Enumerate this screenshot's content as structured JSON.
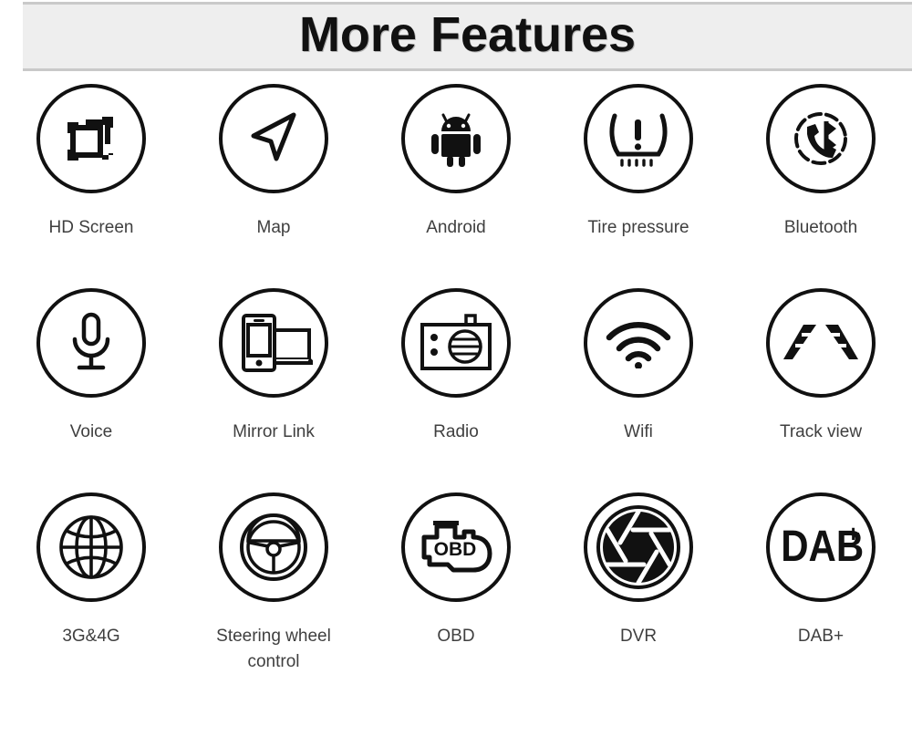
{
  "header": {
    "title": "More Features",
    "background_color": "#eeeeee",
    "border_color": "#c9c9c9",
    "text_color": "#111111"
  },
  "theme": {
    "page_background": "#ffffff",
    "icon_stroke": "#111111",
    "label_color": "#3f3f3f"
  },
  "grid": {
    "columns": 5,
    "rows": 3,
    "rows_data": [
      {
        "cells": [
          {
            "label": "HD Screen",
            "icon": "hd-screen-icon"
          },
          {
            "label": "Map",
            "icon": "navigation-arrow-icon"
          },
          {
            "label": "Android",
            "icon": "android-robot-icon"
          },
          {
            "label": "Tire pressure",
            "icon": "tire-pressure-warning-icon"
          },
          {
            "label": "Bluetooth",
            "icon": "bluetooth-handset-icon"
          }
        ]
      },
      {
        "cells": [
          {
            "label": "Voice",
            "icon": "microphone-icon"
          },
          {
            "label": "Mirror Link",
            "icon": "phone-screen-mirror-icon"
          },
          {
            "label": "Radio",
            "icon": "radio-receiver-icon"
          },
          {
            "label": "Wifi",
            "icon": "wifi-signal-icon"
          },
          {
            "label": "Track view",
            "icon": "parking-track-lines-icon"
          }
        ]
      },
      {
        "cells": [
          {
            "label": "3G&4G",
            "icon": "globe-grid-icon"
          },
          {
            "label": "Steering wheel control",
            "icon": "steering-wheel-icon"
          },
          {
            "label": "OBD",
            "icon": "engine-obd-icon"
          },
          {
            "label": "DVR",
            "icon": "camera-aperture-icon"
          },
          {
            "label": "DAB+",
            "icon": "dab-plus-logo-icon"
          }
        ]
      }
    ]
  }
}
